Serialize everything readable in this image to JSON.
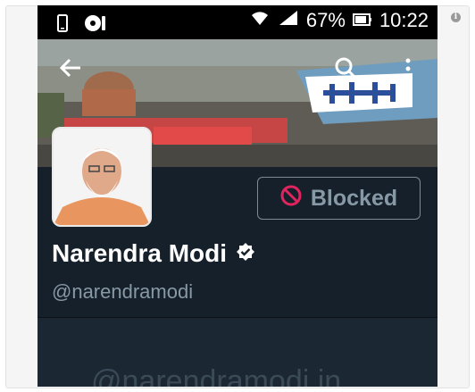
{
  "status_bar": {
    "battery_percent": "67%",
    "time": "10:22"
  },
  "toolbar": {
    "back_icon": "arrow-left-icon",
    "search_icon": "search-icon",
    "menu_icon": "more-vertical-icon"
  },
  "profile": {
    "name": "Narendra Modi",
    "handle": "@narendramodi",
    "blocked_label": "Blocked",
    "verified": true
  },
  "bio_preview": "@narendramodi.in",
  "colors": {
    "background": "#15202b",
    "secondary_text": "#8899a6",
    "blocked_icon": "#e0245e",
    "verified_badge": "#ffffff"
  }
}
